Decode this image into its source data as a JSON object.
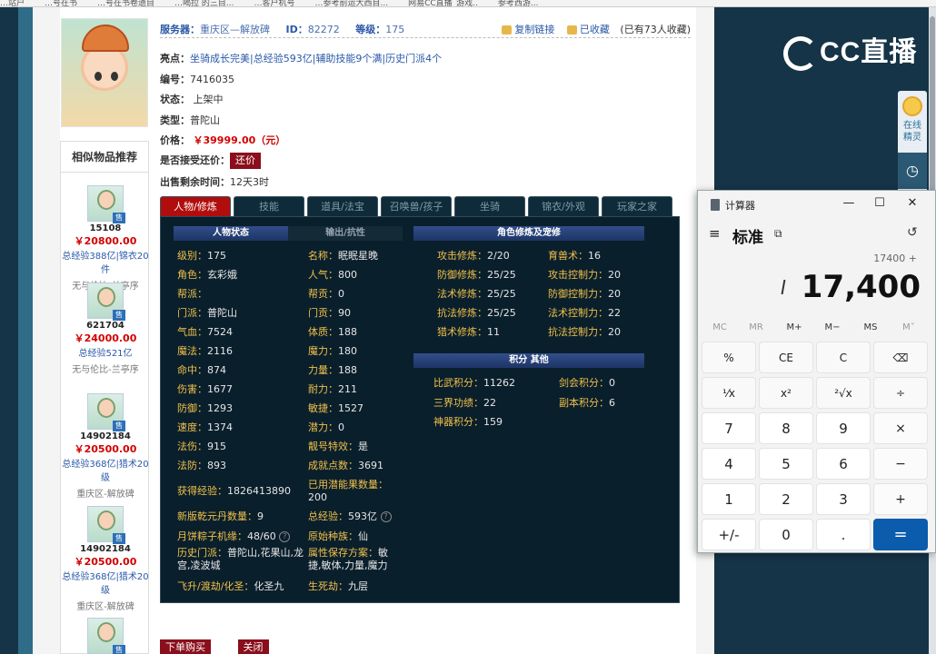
{
  "browser_tabs": [
    "…站户",
    "…号在书",
    "…号在书卷遗目",
    "…喝拉 的三目...",
    "…客户机号",
    "…参考前运大西目...",
    "网易CC直播_游戏..",
    "参考西游..."
  ],
  "header": {
    "server_label": "服务器：",
    "server_value": "重庆区—解放碑",
    "id_label": "ID：",
    "id_value": "82272",
    "level_label": "等级：",
    "level_value": "175",
    "copy_link": "复制链接",
    "favorited": "已收藏",
    "fav_count": "(已有73人收藏)"
  },
  "highlights": {
    "label": "亮点：",
    "value": "坐骑成长完美|总经验593亿|辅助技能9个满|历史门派4个"
  },
  "details": [
    {
      "label": "编号：",
      "value": "7416035"
    },
    {
      "label": "状态：",
      "value": "上架中"
    },
    {
      "label": "类型：",
      "value": "普陀山"
    }
  ],
  "price": {
    "label": "价格：",
    "value": "￥39999.00（元）"
  },
  "bargain": {
    "label": "是否接受还价：",
    "button": "还价"
  },
  "time_left": {
    "label": "出售剩余时间：",
    "value": "12天3时"
  },
  "recommend": {
    "title": "相似物品推荐",
    "items": [
      {
        "id": "15108",
        "price": "￥20800.00",
        "desc": "总经验388亿|锦衣20件",
        "server": "无与伦比-兰亭序"
      },
      {
        "id": "621704",
        "price": "￥24000.00",
        "desc": "总经验521亿",
        "server": "无与伦比-兰亭序"
      },
      {
        "id": "14902184",
        "price": "￥20500.00",
        "desc": "总经验368亿|猎术20级",
        "server": "重庆区-解放碑"
      },
      {
        "id": "14902184",
        "price": "￥20500.00",
        "desc": "总经验368亿|猎术20级",
        "server": "重庆区-解放碑"
      }
    ],
    "badge": "售"
  },
  "tabs": [
    "人物/修炼",
    "技能",
    "道具/法宝",
    "召唤兽/孩子",
    "坐骑",
    "锦衣/外观",
    "玩家之家"
  ],
  "panel": {
    "sect_status": "人物状态",
    "sect_output": "输出/抗性",
    "sect_cultivation": "角色修炼及宠修",
    "sect_points": "积分 其他",
    "left_col": [
      {
        "k": "级别：",
        "v": "175"
      },
      {
        "k": "角色：",
        "v": "玄彩娥"
      },
      {
        "k": "帮派：",
        "v": ""
      },
      {
        "k": "门派：",
        "v": "普陀山"
      },
      {
        "k": "气血：",
        "v": "7524"
      },
      {
        "k": "魔法：",
        "v": "2116"
      },
      {
        "k": "命中：",
        "v": "874"
      },
      {
        "k": "伤害：",
        "v": "1677"
      },
      {
        "k": "防御：",
        "v": "1293"
      },
      {
        "k": "速度：",
        "v": "1374"
      },
      {
        "k": "法伤：",
        "v": "915"
      },
      {
        "k": "法防：",
        "v": "893"
      }
    ],
    "mid_col": [
      {
        "k": "名称：",
        "v": "眠眠星晚"
      },
      {
        "k": "人气：",
        "v": "800"
      },
      {
        "k": "帮贡：",
        "v": "0"
      },
      {
        "k": "门贡：",
        "v": "90"
      },
      {
        "k": "体质：",
        "v": "188"
      },
      {
        "k": "魔力：",
        "v": "180"
      },
      {
        "k": "力量：",
        "v": "188"
      },
      {
        "k": "耐力：",
        "v": "211"
      },
      {
        "k": "敏捷：",
        "v": "1527"
      },
      {
        "k": "潜力：",
        "v": "0"
      },
      {
        "k": "靓号特效：",
        "v": "是"
      },
      {
        "k": "成就点数：",
        "v": "3691"
      }
    ],
    "exp": {
      "k": "获得经验：",
      "v": "1826413890"
    },
    "potential_used": {
      "k": "已用潜能果数量：",
      "v": "200"
    },
    "qian_yuan": {
      "k": "新版乾元丹数量：",
      "v": "9"
    },
    "total_exp": {
      "k": "总经验：",
      "v": "593亿"
    },
    "zongzi": {
      "k": "月饼粽子机缘：",
      "v": "48/60"
    },
    "origin_race": {
      "k": "原始种族：",
      "v": "仙"
    },
    "history_sect": {
      "k": "历史门派：",
      "v": "普陀山,花果山,龙宫,凌波城"
    },
    "attr_scheme": {
      "k": "属性保存方案：",
      "v": "敏捷,敏体,力量,魔力"
    },
    "feisheng": {
      "k": "飞升/渡劫/化圣：",
      "v": "化圣九"
    },
    "shengsijie": {
      "k": "生死劫：",
      "v": "九层"
    },
    "cult_left": [
      {
        "k": "攻击修炼：",
        "v": "2/20"
      },
      {
        "k": "防御修炼：",
        "v": "25/25"
      },
      {
        "k": "法术修炼：",
        "v": "25/25"
      },
      {
        "k": "抗法修炼：",
        "v": "25/25"
      },
      {
        "k": "猎术修炼：",
        "v": "11"
      }
    ],
    "cult_right": [
      {
        "k": "育兽术：",
        "v": "16"
      },
      {
        "k": "攻击控制力：",
        "v": "20"
      },
      {
        "k": "防御控制力：",
        "v": "20"
      },
      {
        "k": "法术控制力：",
        "v": "22"
      },
      {
        "k": "抗法控制力：",
        "v": "20"
      }
    ],
    "points_left": [
      {
        "k": "比武积分：",
        "v": "11262"
      },
      {
        "k": "三界功绩：",
        "v": "22"
      },
      {
        "k": "神器积分：",
        "v": "159"
      }
    ],
    "points_right": [
      {
        "k": "剑会积分：",
        "v": "0"
      },
      {
        "k": "副本积分：",
        "v": "6"
      }
    ]
  },
  "bottom": {
    "buy": "下单购买",
    "close": "关闭"
  },
  "side_widget": {
    "online": "在线",
    "spirit": "精灵"
  },
  "logo_text": "CC直播",
  "calculator": {
    "title": "计算器",
    "mode": "标准",
    "keep_on_top": "⧉",
    "expression": "17400 +",
    "display": "17,400",
    "memory": [
      "MC",
      "MR",
      "M+",
      "M−",
      "MS",
      "M˅"
    ],
    "keys": [
      [
        "%",
        "CE",
        "C",
        "⌫"
      ],
      [
        "¹⁄x",
        "x²",
        "²√x",
        "÷"
      ],
      [
        "7",
        "8",
        "9",
        "×"
      ],
      [
        "4",
        "5",
        "6",
        "−"
      ],
      [
        "1",
        "2",
        "3",
        "+"
      ],
      [
        "+/-",
        "0",
        ".",
        "="
      ]
    ],
    "minimize": "—",
    "maximize": "☐",
    "close": "✕",
    "menu_icon": "≡",
    "history_icon": "↺"
  }
}
